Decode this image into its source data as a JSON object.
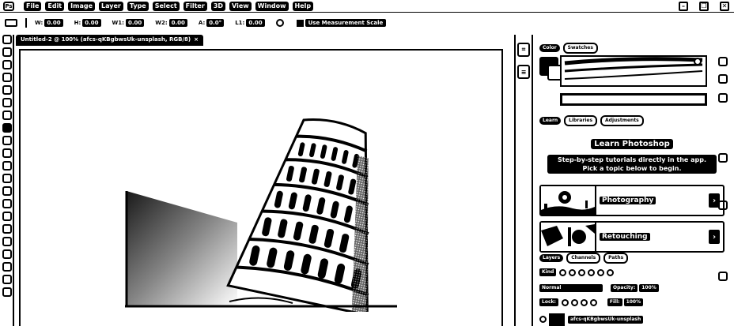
{
  "menubar": {
    "logo": "Ps",
    "items": [
      "File",
      "Edit",
      "Image",
      "Layer",
      "Type",
      "Select",
      "Filter",
      "3D",
      "View",
      "Window",
      "Help"
    ],
    "window_controls": [
      "–",
      "❐",
      "✕"
    ]
  },
  "options": {
    "fields": [
      {
        "label": "W:",
        "value": "0.00"
      },
      {
        "label": "H:",
        "value": "0.00"
      },
      {
        "label": "W1:",
        "value": "0.00"
      },
      {
        "label": "W2:",
        "value": "0.00"
      },
      {
        "label": "A:",
        "value": "0.0°"
      },
      {
        "label": "L1:",
        "value": "0.00"
      }
    ],
    "scale_button": "Use Measurement Scale"
  },
  "document": {
    "tab_title": "Untitled-2 @ 100% (afcs-qKBgbwsUk-unsplash, RGB/8)",
    "close": "×"
  },
  "panels": {
    "color_tabs": [
      "Color",
      "Swatches"
    ],
    "learn_tabs": [
      "Learn",
      "Libraries",
      "Adjustments"
    ],
    "learn_title": "Learn Photoshop",
    "learn_desc": "Step-by-step tutorials directly in the app. Pick a topic below to begin.",
    "cards": [
      {
        "label": "Photography",
        "chevron": "›"
      },
      {
        "label": "Retouching",
        "chevron": "›"
      }
    ],
    "layer_tabs": [
      "Layers",
      "Channels",
      "Paths"
    ],
    "layers_kind": "Kind",
    "blend_mode": "Normal",
    "opacity_label": "Opacity:",
    "opacity_value": "100%",
    "lock_label": "Lock:",
    "fill_label": "Fill:",
    "fill_value": "100%",
    "layer_name": "afcs-qKBgbwsUk-unsplash"
  }
}
